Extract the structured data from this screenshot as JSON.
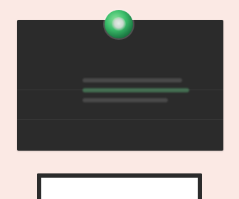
{
  "page": {
    "title": "",
    "colors": {
      "background": "#fbe9e4",
      "card": "#2b2b2b",
      "accent_green": "#3cbf6b",
      "panel": "#ffffff"
    }
  },
  "dark_card": {
    "heading": "",
    "subheading": ""
  },
  "icons": {
    "avatar": "avatar-icon"
  }
}
